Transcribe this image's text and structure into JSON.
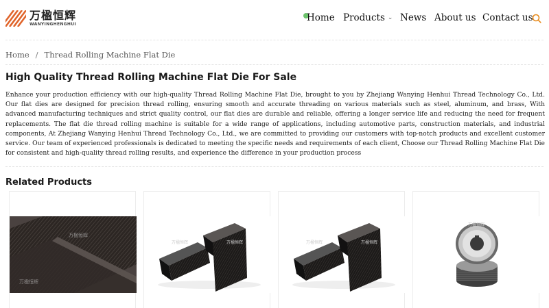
{
  "header": {
    "logo_cn": "万楹恒辉",
    "logo_en": "WANYINGHENGHUI",
    "nav": [
      {
        "label": "Home",
        "has_dropdown": false
      },
      {
        "label": "Products",
        "has_dropdown": true
      },
      {
        "label": "News",
        "has_dropdown": false
      },
      {
        "label": "About us",
        "has_dropdown": false
      },
      {
        "label": "Contact us",
        "has_dropdown": false
      }
    ],
    "search_icon": "search-icon",
    "accent_color": "#e88a1a",
    "dot_color": "#6cc36c"
  },
  "breadcrumb": {
    "items": [
      "Home",
      "Thread Rolling Machine Flat Die"
    ],
    "separator": "/"
  },
  "main": {
    "title": "High Quality Thread Rolling Machine Flat Die For Sale",
    "description": "Enhance your production efficiency with our high-quality Thread Rolling Machine Flat Die, brought to you by Zhejiang Wanying Henhui Thread Technology Co., Ltd. Our flat dies are designed for precision thread rolling, ensuring smooth and accurate threading on various materials such as steel, aluminum, and brass, With advanced manufacturing techniques and strict quality control, our flat dies are durable and reliable, offering a longer service life and reducing the need for frequent replacements. The flat die thread rolling machine is suitable for a wide range of applications, including automotive parts, construction materials, and industrial components, At Zhejiang Wanying Henhui Thread Technology Co., Ltd., we are committed to providing our customers with top-notch products and excellent customer service. Our team of experienced professionals is dedicated to meeting the specific needs and requirements of each client, Choose our Thread Rolling Machine Flat Die for consistent and high-quality thread rolling results, and experience the difference in your production process"
  },
  "related": {
    "title": "Related Products",
    "products": [
      {
        "image": "flat-die-closeup",
        "watermark": "万楹恒辉"
      },
      {
        "image": "flat-die-pair",
        "watermark": "万楹恒辉"
      },
      {
        "image": "flat-die-pair",
        "watermark": "万楹恒辉"
      },
      {
        "image": "round-thread-rolling-dies",
        "watermark": "万楹恒辉"
      }
    ]
  }
}
